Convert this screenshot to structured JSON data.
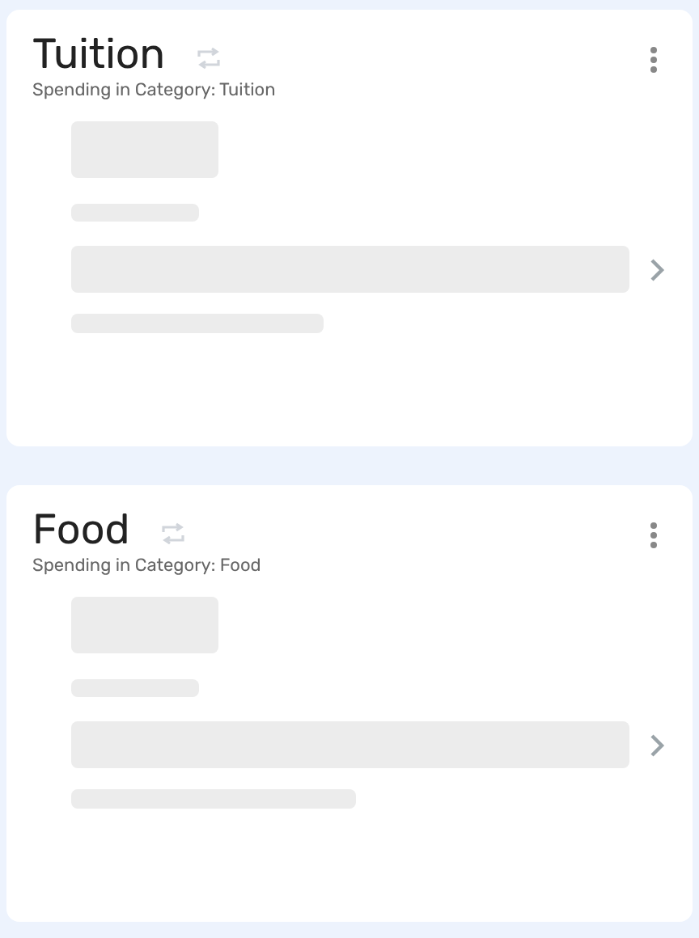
{
  "cards": [
    {
      "title": "Tuition",
      "subtitle": "Spending in Category: Tuition"
    },
    {
      "title": "Food",
      "subtitle": "Spending in Category: Food"
    }
  ]
}
